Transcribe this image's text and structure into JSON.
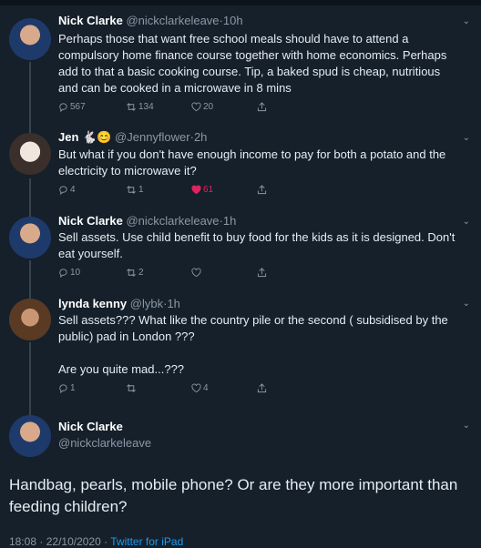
{
  "tweets": [
    {
      "name": "Nick Clarke",
      "handle": "@nickclarkeleave",
      "time": "10h",
      "text": "Perhaps those that want free school meals should have to attend a compulsory home finance course together with home economics. Perhaps add to that a basic cooking course. Tip, a baked spud is cheap, nutritious and can be cooked in a microwave in 8 mins",
      "replies": "567",
      "retweets": "134",
      "likes": "20"
    },
    {
      "name": "Jen",
      "name_emojis": "🐇😊",
      "handle": "@Jennyflower",
      "time": "2h",
      "text": "But what if you don't have enough income to pay for both a potato and the electricity to microwave it?",
      "replies": "4",
      "retweets": "1",
      "likes": "61"
    },
    {
      "name": "Nick Clarke",
      "handle": "@nickclarkeleave",
      "time": "1h",
      "text": "Sell assets. Use child benefit to buy food for the kids as it is designed. Don't eat yourself.",
      "replies": "10",
      "retweets": "2",
      "likes": ""
    },
    {
      "name": "lynda kenny",
      "handle": "@lybk",
      "time": "1h",
      "text": "Sell assets??? What like the country pile or the second ( subsidised by the public) pad in London ???",
      "text2": "Are you quite mad...???",
      "replies": "1",
      "retweets": "",
      "likes": "4"
    }
  ],
  "main_tweet": {
    "name": "Nick Clarke",
    "handle": "@nickclarkeleave",
    "text": "Handbag, pearls, mobile phone? Or are they more important than feeding children?",
    "time": "18:08",
    "date": "22/10/2020",
    "client": "Twitter for iPad"
  },
  "separator": "·",
  "colors": {
    "background": "#15202b",
    "like_active": "#e0245e",
    "link": "#1d9bf0"
  },
  "icons": [
    "reply-icon",
    "retweet-icon",
    "like-icon",
    "share-icon",
    "chevron-down-icon"
  ]
}
